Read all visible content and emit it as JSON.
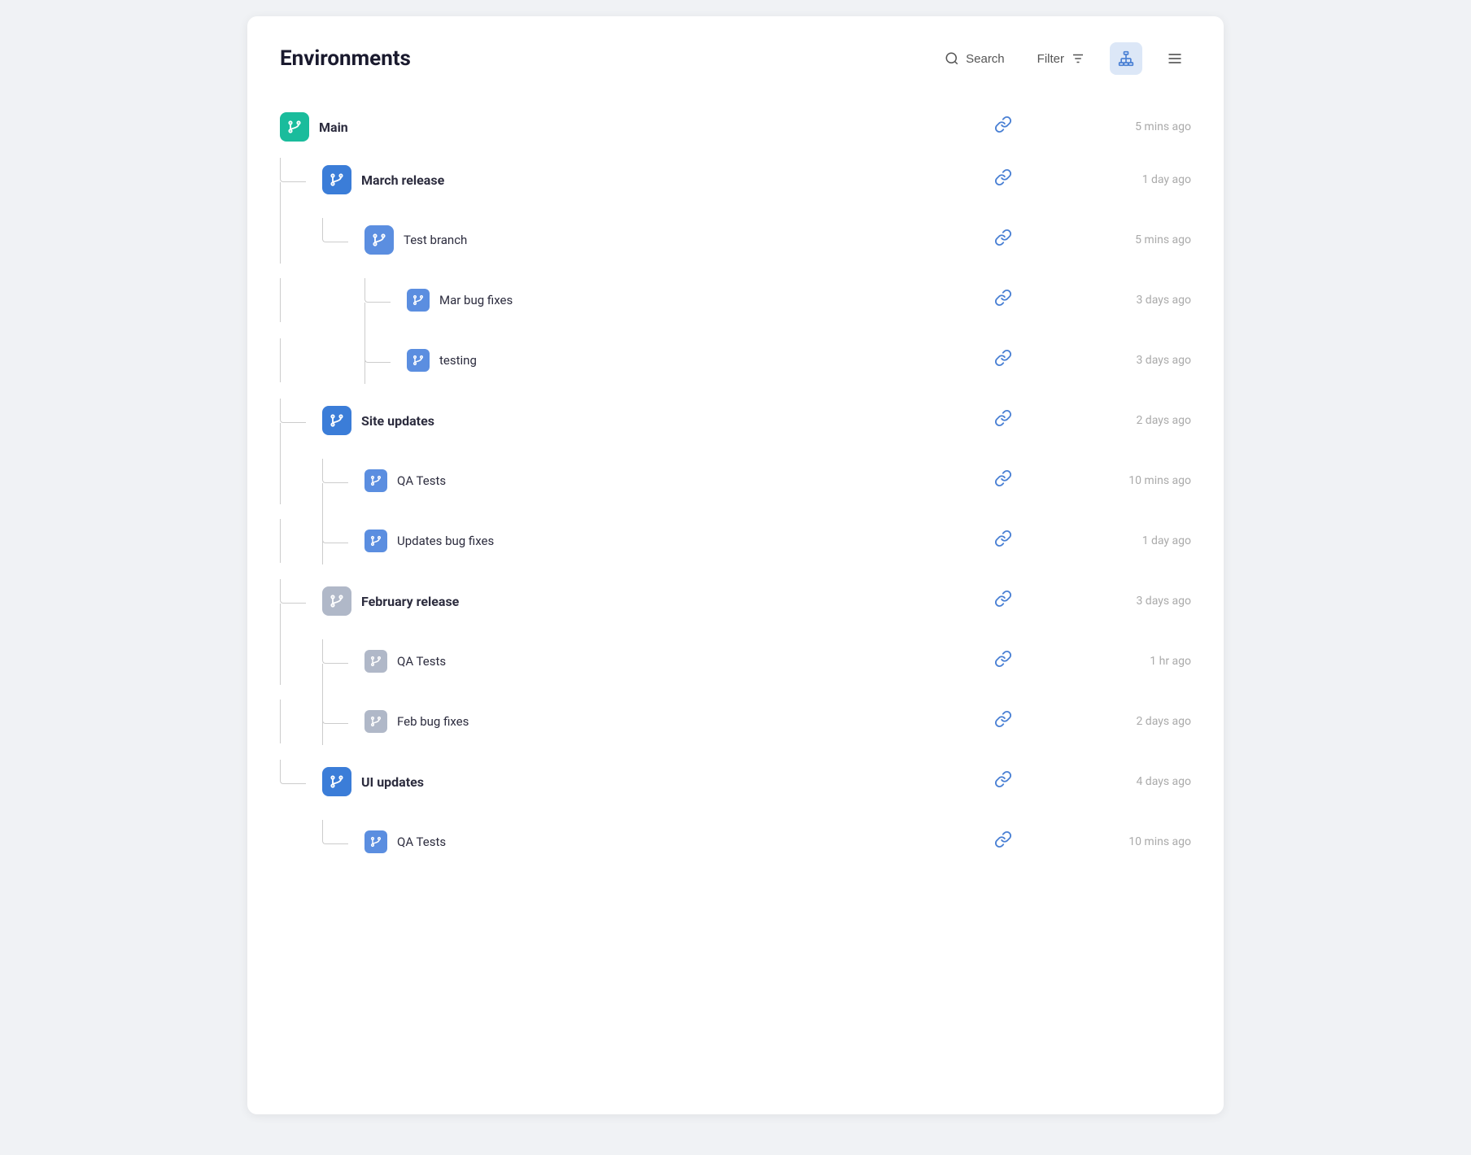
{
  "header": {
    "title": "Environments",
    "search_label": "Search",
    "filter_label": "Filter",
    "search_placeholder": "Search"
  },
  "toolbar": {
    "hierarchy_icon": "hierarchy",
    "menu_icon": "menu"
  },
  "tree": [
    {
      "id": "main",
      "label": "Main",
      "level": 0,
      "bold": true,
      "icon_color": "teal",
      "time": "5 mins ago",
      "has_link": true
    },
    {
      "id": "march-release",
      "label": "March release",
      "level": 1,
      "bold": true,
      "icon_color": "blue",
      "time": "1 day ago",
      "has_link": true,
      "parent": "main"
    },
    {
      "id": "test-branch",
      "label": "Test branch",
      "level": 2,
      "bold": false,
      "icon_color": "blue-mid",
      "time": "5 mins ago",
      "has_link": true,
      "parent": "march-release"
    },
    {
      "id": "mar-bug-fixes",
      "label": "Mar bug fixes",
      "level": 3,
      "bold": false,
      "icon_color": "blue-mid",
      "icon_size": "small",
      "time": "3 days ago",
      "has_link": true,
      "parent": "test-branch"
    },
    {
      "id": "testing",
      "label": "testing",
      "level": 3,
      "bold": false,
      "icon_color": "blue-mid",
      "icon_size": "small",
      "time": "3 days ago",
      "has_link": true,
      "parent": "test-branch",
      "last_sibling": true
    },
    {
      "id": "site-updates",
      "label": "Site updates",
      "level": 1,
      "bold": true,
      "icon_color": "blue",
      "time": "2 days ago",
      "has_link": true,
      "parent": "main"
    },
    {
      "id": "qa-tests-site",
      "label": "QA Tests",
      "level": 2,
      "bold": false,
      "icon_color": "blue-mid",
      "icon_size": "small",
      "time": "10 mins ago",
      "has_link": true,
      "parent": "site-updates"
    },
    {
      "id": "updates-bug-fixes",
      "label": "Updates bug fixes",
      "level": 2,
      "bold": false,
      "icon_color": "blue-mid",
      "icon_size": "small",
      "time": "1 day ago",
      "has_link": true,
      "parent": "site-updates",
      "last_sibling": true
    },
    {
      "id": "february-release",
      "label": "February release",
      "level": 1,
      "bold": true,
      "icon_color": "gray",
      "time": "3 days ago",
      "has_link": true,
      "parent": "main"
    },
    {
      "id": "qa-tests-feb",
      "label": "QA Tests",
      "level": 2,
      "bold": false,
      "icon_color": "gray",
      "icon_size": "small",
      "time": "1 hr ago",
      "has_link": true,
      "parent": "february-release"
    },
    {
      "id": "feb-bug-fixes",
      "label": "Feb bug fixes",
      "level": 2,
      "bold": false,
      "icon_color": "gray",
      "icon_size": "small",
      "time": "2 days ago",
      "has_link": true,
      "parent": "february-release",
      "last_sibling": true
    },
    {
      "id": "ui-updates",
      "label": "UI updates",
      "level": 1,
      "bold": true,
      "icon_color": "blue",
      "time": "4 days ago",
      "has_link": true,
      "parent": "main"
    },
    {
      "id": "qa-tests-ui",
      "label": "QA Tests",
      "level": 2,
      "bold": false,
      "icon_color": "blue-mid",
      "icon_size": "small",
      "time": "10 mins ago",
      "has_link": true,
      "parent": "ui-updates"
    }
  ]
}
